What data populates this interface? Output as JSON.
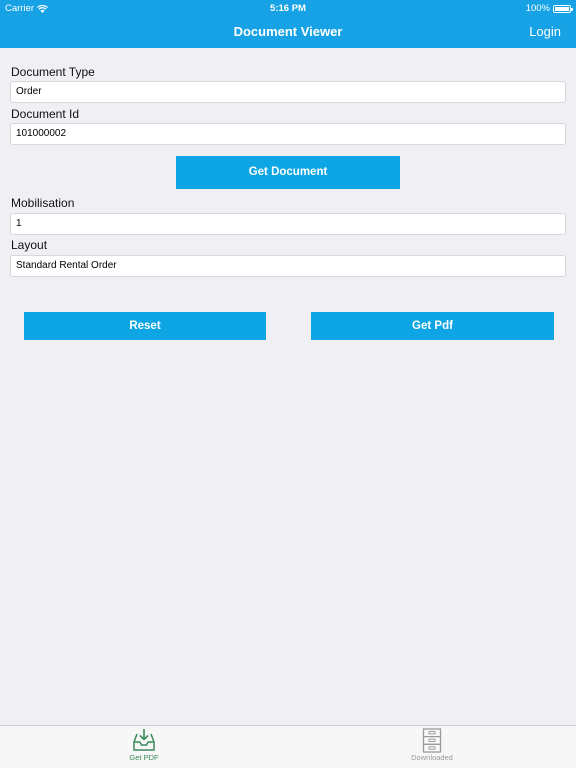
{
  "status": {
    "carrier": "Carrier",
    "time": "5:16 PM",
    "battery": "100%"
  },
  "navbar": {
    "title": "Document Viewer",
    "login": "Login"
  },
  "form": {
    "document_type": {
      "label": "Document Type",
      "value": "Order"
    },
    "document_id": {
      "label": "Document Id",
      "value": "101000002"
    },
    "get_document_label": "Get Document",
    "mobilisation": {
      "label": "Mobilisation",
      "value": "1"
    },
    "layout": {
      "label": "Layout",
      "value": "Standard Rental Order"
    },
    "reset_label": "Reset",
    "get_pdf_label": "Get Pdf"
  },
  "tabbar": {
    "tabs": [
      {
        "label": "Get PDF",
        "icon": "inbox-download-icon",
        "active": true
      },
      {
        "label": "Downloaded",
        "icon": "file-cabinet-icon",
        "active": false
      }
    ]
  },
  "colors": {
    "accent": "#16a2e5",
    "button": "#0da5e3",
    "active_tab": "#3a8a5a",
    "inactive_tab": "#9a9a9a"
  }
}
